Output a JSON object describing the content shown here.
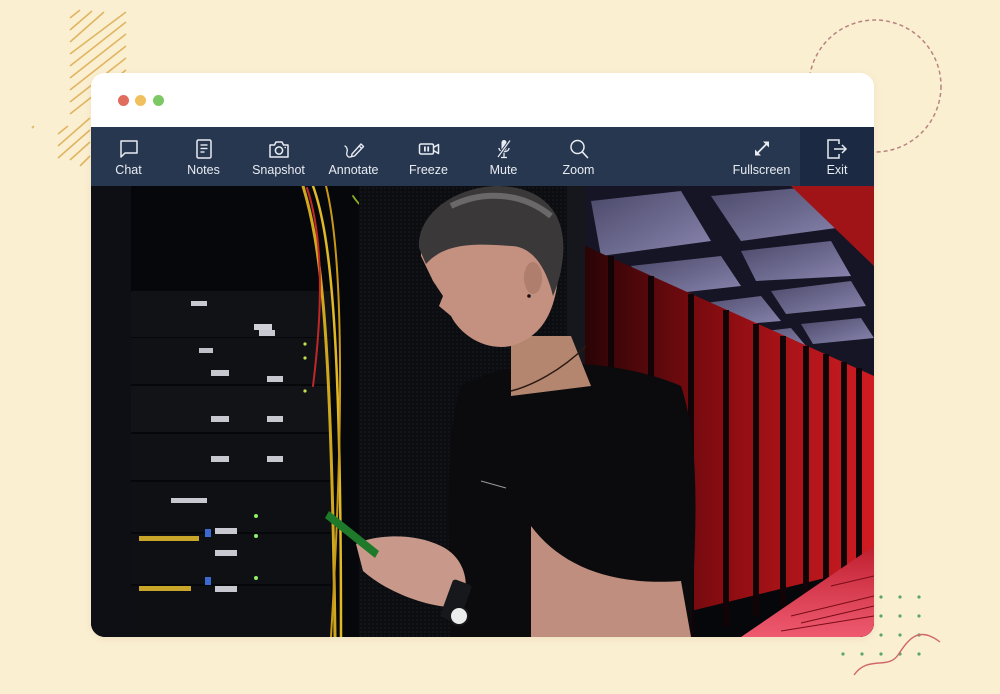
{
  "window": {
    "controls": [
      "close",
      "minimize",
      "maximize"
    ]
  },
  "toolbar": {
    "items": [
      {
        "label": "Chat",
        "icon": "chat-bubble-icon"
      },
      {
        "label": "Notes",
        "icon": "notes-icon"
      },
      {
        "label": "Snapshot",
        "icon": "camera-icon"
      },
      {
        "label": "Annotate",
        "icon": "pencil-icon"
      },
      {
        "label": "Freeze",
        "icon": "video-pause-icon"
      },
      {
        "label": "Mute",
        "icon": "microphone-muted-icon"
      },
      {
        "label": "Zoom",
        "icon": "magnifier-icon"
      },
      {
        "label": "Fullscreen",
        "icon": "expand-arrows-icon"
      },
      {
        "label": "Exit",
        "icon": "exit-icon"
      }
    ]
  },
  "video": {
    "description": "Live video feed: technician in a black t-shirt holding a smartphone in a server room with racks and red-lit aisle"
  },
  "colors": {
    "background": "#fbefd2",
    "toolbar": "#283750",
    "toolbar_exit": "#1b2a42",
    "toolbar_text": "#e8ecf2",
    "dot_red": "#e06c5e",
    "dot_yellow": "#f0c060",
    "dot_green": "#7cc865"
  }
}
